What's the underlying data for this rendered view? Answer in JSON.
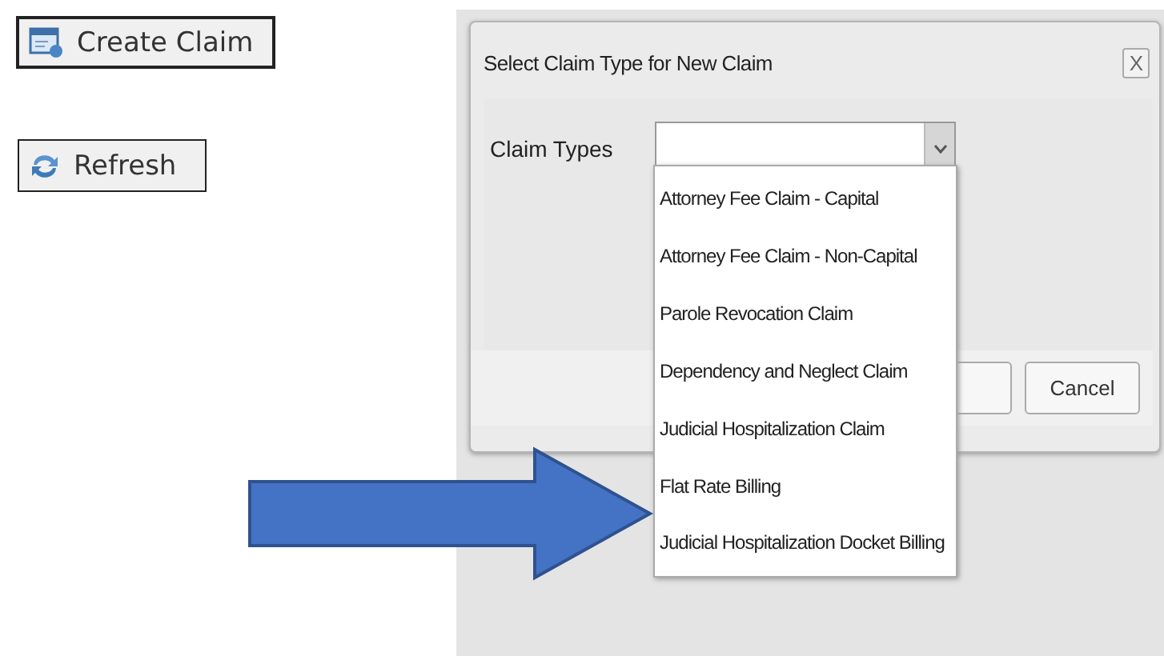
{
  "toolbar": {
    "buttons": [
      {
        "label": "Create Claim",
        "kind": "create"
      },
      {
        "label": "Refresh",
        "kind": "refresh"
      }
    ]
  },
  "dialog": {
    "title": "Select Claim Type for New Claim",
    "close": "X",
    "field": {
      "label": "Claim Types",
      "expanded": true
    },
    "options": [
      "Attorney Fee Claim - Capital",
      "Attorney Fee Claim - Non-Capital",
      "Parole Revocation Claim",
      "Dependency and Neglect Claim",
      "Judicial Hospitalization Claim",
      "Flat Rate Billing",
      "Judicial Hospitalization Docket Billing"
    ],
    "buttons": [
      "Cancel"
    ]
  }
}
